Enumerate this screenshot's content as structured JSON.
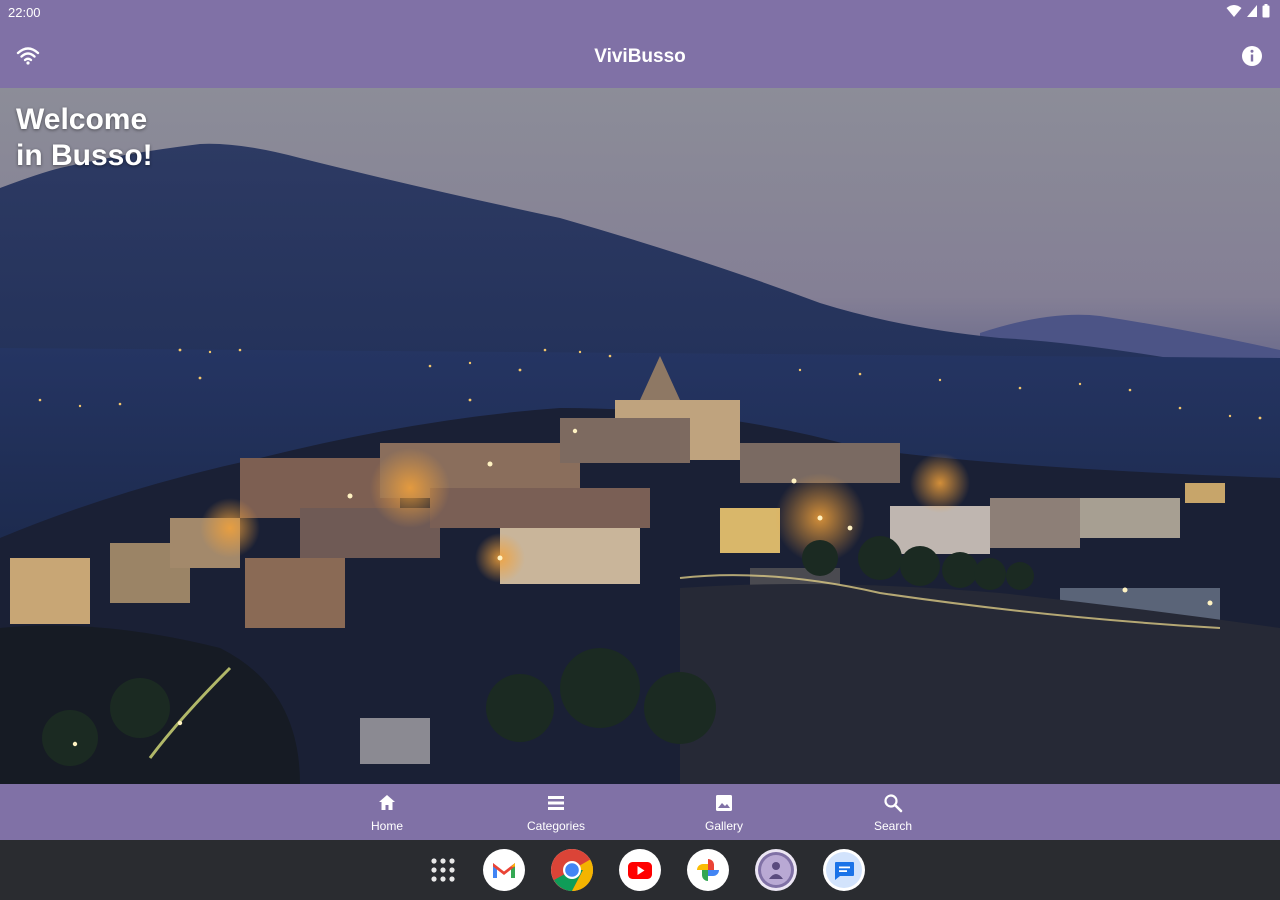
{
  "status_bar": {
    "time": "22:00"
  },
  "app_bar": {
    "title": "ViviBusso"
  },
  "hero": {
    "welcome_line1": "Welcome",
    "welcome_line2": "in Busso!"
  },
  "bottom_nav": {
    "items": [
      {
        "label": "Home",
        "icon": "home-icon"
      },
      {
        "label": "Categories",
        "icon": "list-icon"
      },
      {
        "label": "Gallery",
        "icon": "image-icon"
      },
      {
        "label": "Search",
        "icon": "search-icon"
      }
    ]
  },
  "taskbar": {
    "apps": [
      "apps-grid-icon",
      "gmail-icon",
      "chrome-icon",
      "youtube-icon",
      "photos-icon",
      "profile-app-icon",
      "messages-icon"
    ]
  },
  "colors": {
    "accent": "#8071a6",
    "taskbar": "#2a2c30"
  }
}
